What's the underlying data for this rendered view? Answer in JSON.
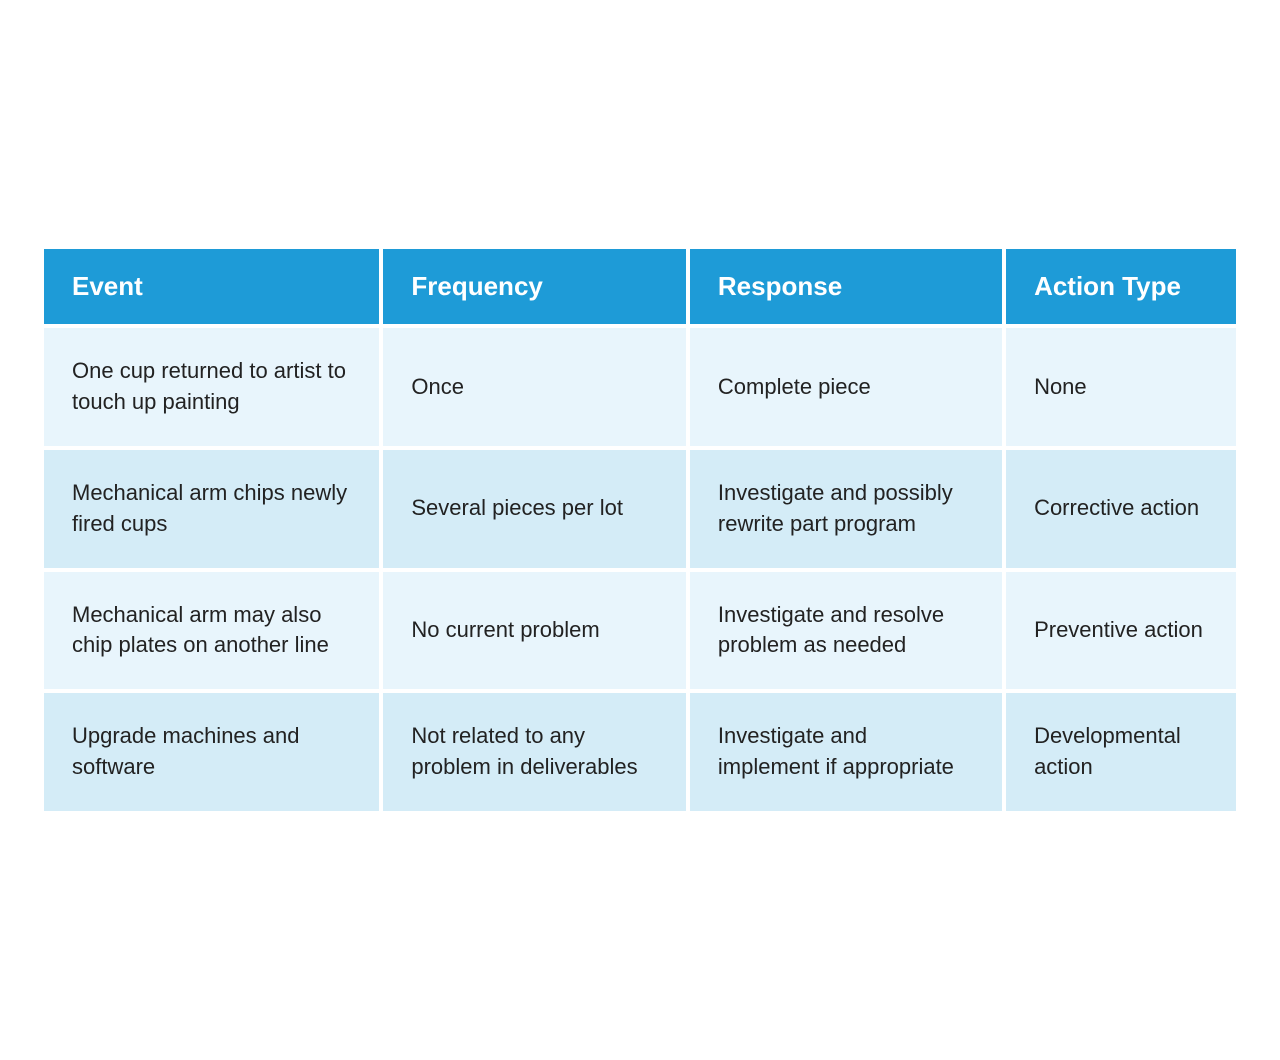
{
  "header": {
    "col1": "Event",
    "col2": "Frequency",
    "col3": "Response",
    "col4": "Action Type"
  },
  "rows": [
    {
      "event": "One cup returned to artist to touch up painting",
      "frequency": "Once",
      "response": "Complete piece",
      "action_type": "None"
    },
    {
      "event": "Mechanical arm chips newly fired cups",
      "frequency": "Several pieces per lot",
      "response": "Investigate and possibly rewrite part program",
      "action_type": "Corrective action"
    },
    {
      "event": "Mechanical arm may also chip plates on another line",
      "frequency": "No current problem",
      "response": "Investigate and resolve problem as needed",
      "action_type": "Preventive action"
    },
    {
      "event": "Upgrade machines and software",
      "frequency": "Not related to any problem in deliverables",
      "response": "Investigate and implement if appropriate",
      "action_type": "Developmental action"
    }
  ]
}
